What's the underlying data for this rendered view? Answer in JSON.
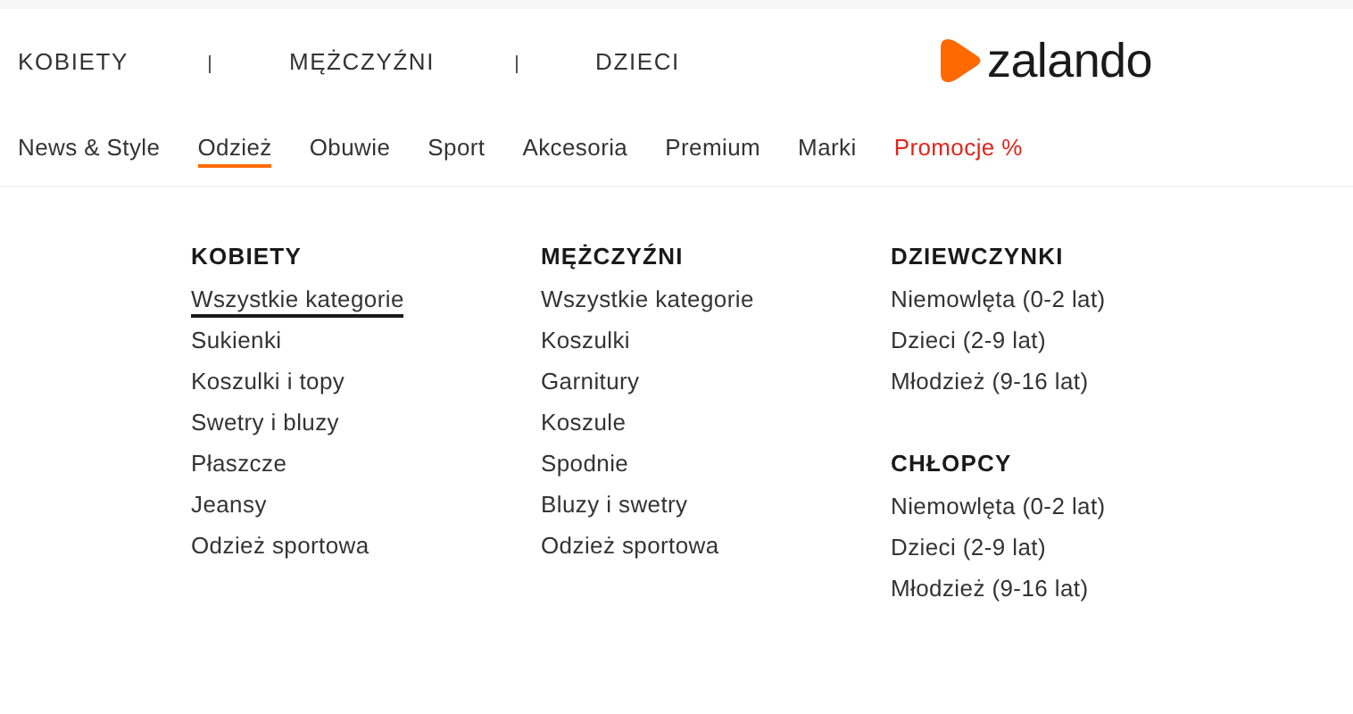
{
  "top_nav": [
    {
      "label": "KOBIETY"
    },
    {
      "label": "MĘŻCZYŹNI"
    },
    {
      "label": "DZIECI"
    }
  ],
  "logo": {
    "text": "zalando"
  },
  "categories": [
    {
      "label": "News & Style",
      "selected": false,
      "kind": "normal"
    },
    {
      "label": "Odzież",
      "selected": true,
      "kind": "normal"
    },
    {
      "label": "Obuwie",
      "selected": false,
      "kind": "normal"
    },
    {
      "label": "Sport",
      "selected": false,
      "kind": "normal"
    },
    {
      "label": "Akcesoria",
      "selected": false,
      "kind": "normal"
    },
    {
      "label": "Premium",
      "selected": false,
      "kind": "normal"
    },
    {
      "label": "Marki",
      "selected": false,
      "kind": "normal"
    },
    {
      "label": "Promocje %",
      "selected": false,
      "kind": "promo"
    }
  ],
  "menu_columns": [
    {
      "groups": [
        {
          "heading": "KOBIETY",
          "items": [
            {
              "label": "Wszystkie kategorie",
              "selected": true
            },
            {
              "label": "Sukienki",
              "selected": false
            },
            {
              "label": "Koszulki i topy",
              "selected": false
            },
            {
              "label": "Swetry i bluzy",
              "selected": false
            },
            {
              "label": "Płaszcze",
              "selected": false
            },
            {
              "label": "Jeansy",
              "selected": false
            },
            {
              "label": "Odzież sportowa",
              "selected": false
            }
          ]
        }
      ]
    },
    {
      "groups": [
        {
          "heading": "MĘŻCZYŹNI",
          "items": [
            {
              "label": "Wszystkie kategorie",
              "selected": false
            },
            {
              "label": "Koszulki",
              "selected": false
            },
            {
              "label": "Garnitury",
              "selected": false
            },
            {
              "label": "Koszule",
              "selected": false
            },
            {
              "label": "Spodnie",
              "selected": false
            },
            {
              "label": "Bluzy i swetry",
              "selected": false
            },
            {
              "label": "Odzież sportowa",
              "selected": false
            }
          ]
        }
      ]
    },
    {
      "groups": [
        {
          "heading": "DZIEWCZYNKI",
          "items": [
            {
              "label": "Niemowlęta (0-2 lat)",
              "selected": false
            },
            {
              "label": "Dzieci (2-9 lat)",
              "selected": false
            },
            {
              "label": "Młodzież (9-16 lat)",
              "selected": false
            }
          ]
        },
        {
          "heading": "CHŁOPCY",
          "items": [
            {
              "label": "Niemowlęta (0-2 lat)",
              "selected": false
            },
            {
              "label": "Dzieci (2-9 lat)",
              "selected": false
            },
            {
              "label": "Młodzież (9-16 lat)",
              "selected": false
            }
          ]
        }
      ]
    }
  ]
}
